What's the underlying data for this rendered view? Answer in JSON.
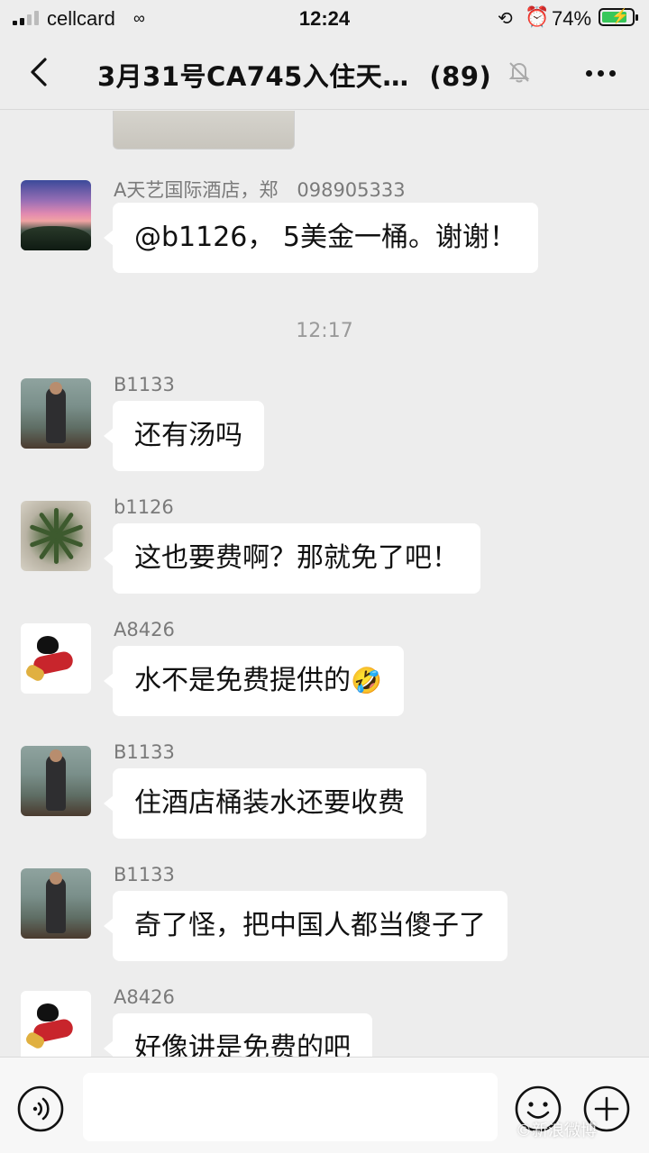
{
  "status_bar": {
    "carrier": "cellcard",
    "time": "12:24",
    "battery_percent": "74%",
    "battery_level": 0.74,
    "icons": [
      "signal-icon",
      "link-icon",
      "orientation-lock-icon",
      "alarm-icon",
      "battery-charging-icon"
    ]
  },
  "header": {
    "title": "3月31号CA745入住天…",
    "member_count": "(89)",
    "muted": true,
    "icons": [
      "back-chevron-icon",
      "muted-bell-icon",
      "more-dots-icon"
    ]
  },
  "messages": [
    {
      "sender": "A天艺国际酒店，郑　098905333",
      "text": "@b1126， 5美金一桶。谢谢！",
      "avatar": "sunset-avatar"
    },
    {
      "sender": "B1133",
      "text": "还有汤吗",
      "avatar": "man-car-avatar"
    },
    {
      "sender": "b1126",
      "text": "这也要费啊？那就免了吧！",
      "avatar": "plant-avatar"
    },
    {
      "sender": "A8426",
      "text": "水不是免费提供的",
      "emoji": "🤣",
      "avatar": "cartoon-avatar"
    },
    {
      "sender": "B1133",
      "text": "住酒店桶装水还要收费",
      "avatar": "man-car-avatar"
    },
    {
      "sender": "B1133",
      "text": "奇了怪，把中国人都当傻子了",
      "avatar": "man-car-avatar"
    },
    {
      "sender": "A8426",
      "text": "好像讲是免费的吧",
      "avatar": "cartoon-avatar"
    }
  ],
  "time_separator": "12:17",
  "input_bar": {
    "value": "",
    "placeholder": "",
    "icons": [
      "voice-icon",
      "emoji-icon",
      "plus-icon"
    ]
  },
  "watermark": "©新浪微博"
}
